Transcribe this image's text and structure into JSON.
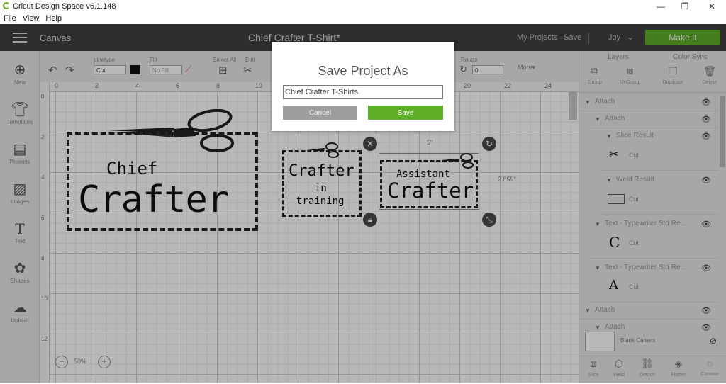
{
  "window": {
    "title": "Cricut Design Space  v6.1.148",
    "controls": [
      "—",
      "❐",
      "✕"
    ]
  },
  "menu": [
    "File",
    "View",
    "Help"
  ],
  "header": {
    "canvas_label": "Canvas",
    "project_title": "Chief Crafter T-Shirt*",
    "my_projects": "My Projects",
    "save": "Save",
    "user": "Joy",
    "make_it": "Make It"
  },
  "toolbar": {
    "linetype_label": "Linetype",
    "linetype_value": "Cut",
    "fill_label": "Fill",
    "fill_value": "No Fill",
    "select_all_label": "Select All",
    "edit_label": "Edit",
    "rotate_label": "Rotate",
    "rotate_value": "0",
    "more_label": "More▾"
  },
  "left_nav": [
    {
      "icon": "plus-circle-icon",
      "label": "New"
    },
    {
      "icon": "tshirt-icon",
      "label": "Templates"
    },
    {
      "icon": "projects-icon",
      "label": "Projects"
    },
    {
      "icon": "image-icon",
      "label": "Images"
    },
    {
      "icon": "text-icon",
      "label": "Text"
    },
    {
      "icon": "shapes-icon",
      "label": "Shapes"
    },
    {
      "icon": "upload-icon",
      "label": "Upload"
    }
  ],
  "ruler": {
    "top": [
      "0",
      "2",
      "4",
      "6",
      "8",
      "10",
      "12",
      "20",
      "22",
      "24"
    ],
    "left": [
      "0",
      "2",
      "4",
      "6",
      "8",
      "10",
      "12"
    ]
  },
  "canvas": {
    "zoom": "50%",
    "dim_width": "5\"",
    "dim_height": "2.859\"",
    "design_left": {
      "line1": "Chief",
      "line2": "Crafter"
    },
    "design_mid": {
      "line1": "Crafter",
      "line2": "in",
      "line3": "training"
    },
    "design_right": {
      "line1": "Assistant",
      "line2": "Crafter"
    }
  },
  "right_panel": {
    "tabs": [
      "Layers",
      "Color Sync"
    ],
    "tools": [
      "Group",
      "UnGroup",
      "Duplicate",
      "Delete"
    ],
    "layers": [
      {
        "name": "Attach"
      },
      {
        "name": "Attach"
      },
      {
        "name": "Slice Result"
      },
      {
        "name": "Cut"
      },
      {
        "name": "Weld Result"
      },
      {
        "name": "Cut"
      },
      {
        "name": "Text - Typewriter Std Re..."
      },
      {
        "name": "Cut",
        "glyph": "C"
      },
      {
        "name": "Text - Typewriter Std Re..."
      },
      {
        "name": "Cut",
        "glyph": "A"
      },
      {
        "name": "Attach"
      },
      {
        "name": "Attach"
      }
    ],
    "blank_canvas": "Blank Canvas",
    "bottom_tools": [
      "Slice",
      "Weld",
      "Detach",
      "Flatten",
      "Contour"
    ]
  },
  "dialog": {
    "title": "Save Project As",
    "input_value": "Chief Crafter T-Shirts",
    "cancel": "Cancel",
    "save": "Save"
  }
}
